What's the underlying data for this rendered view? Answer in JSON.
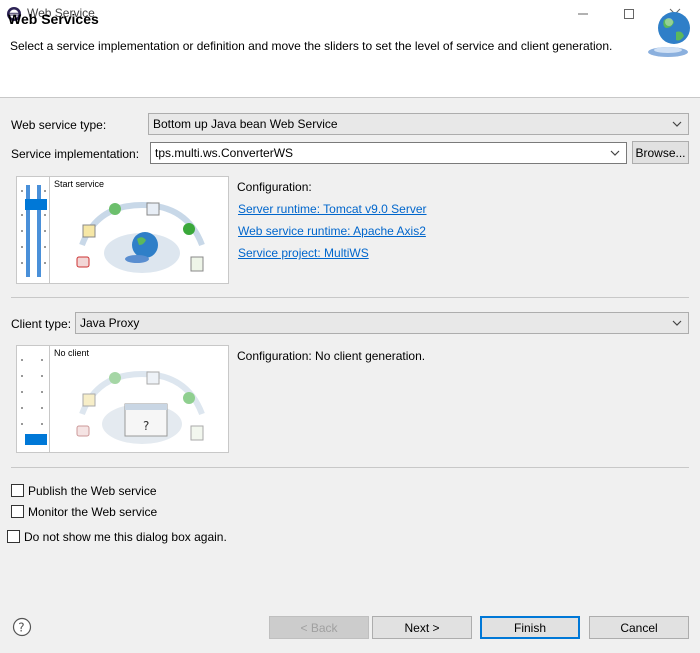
{
  "window": {
    "title": "Web Service"
  },
  "header": {
    "title": "Web Services",
    "description": "Select a service implementation or definition and move the sliders to set the level of service and client generation."
  },
  "service": {
    "type_label": "Web service type:",
    "type_value": "Bottom up Java bean Web Service",
    "impl_label": "Service implementation:",
    "impl_value": "tps.multi.ws.ConverterWS",
    "browse_label": "Browse...",
    "slider_caption": "Start service",
    "config_heading": "Configuration:",
    "links": {
      "server_runtime": "Server runtime: Tomcat v9.0 Server",
      "ws_runtime": "Web service runtime: Apache Axis2",
      "project": "Service project: MultiWS"
    }
  },
  "client": {
    "type_label": "Client type:",
    "type_value": "Java Proxy",
    "slider_caption": "No client",
    "config_text": "Configuration: No client generation."
  },
  "options": {
    "publish": "Publish the Web service",
    "monitor": "Monitor the Web service",
    "dont_show": "Do not show me this dialog box again."
  },
  "footer": {
    "back": "< Back",
    "next": "Next >",
    "finish": "Finish",
    "cancel": "Cancel"
  },
  "colors": {
    "accent": "#0078d7",
    "link": "#0066cc"
  }
}
